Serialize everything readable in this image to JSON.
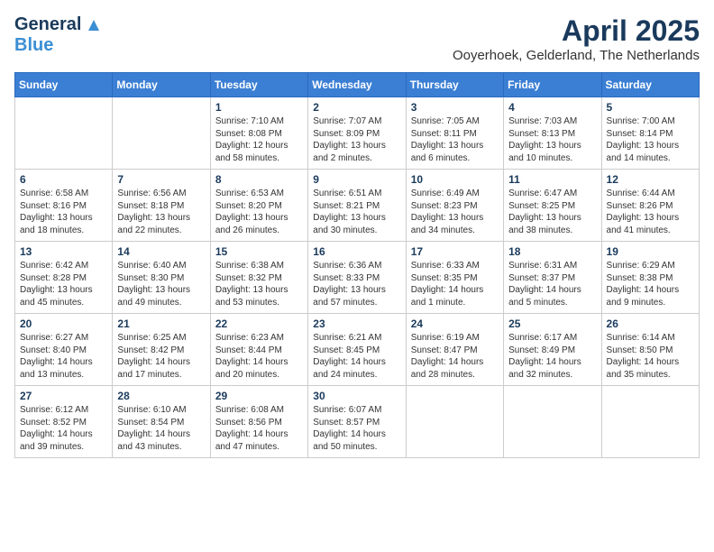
{
  "logo": {
    "general": "General",
    "blue": "Blue"
  },
  "title": "April 2025",
  "location": "Ooyerhoek, Gelderland, The Netherlands",
  "days_of_week": [
    "Sunday",
    "Monday",
    "Tuesday",
    "Wednesday",
    "Thursday",
    "Friday",
    "Saturday"
  ],
  "weeks": [
    [
      {
        "day": "",
        "info": ""
      },
      {
        "day": "",
        "info": ""
      },
      {
        "day": "1",
        "info": "Sunrise: 7:10 AM\nSunset: 8:08 PM\nDaylight: 12 hours and 58 minutes."
      },
      {
        "day": "2",
        "info": "Sunrise: 7:07 AM\nSunset: 8:09 PM\nDaylight: 13 hours and 2 minutes."
      },
      {
        "day": "3",
        "info": "Sunrise: 7:05 AM\nSunset: 8:11 PM\nDaylight: 13 hours and 6 minutes."
      },
      {
        "day": "4",
        "info": "Sunrise: 7:03 AM\nSunset: 8:13 PM\nDaylight: 13 hours and 10 minutes."
      },
      {
        "day": "5",
        "info": "Sunrise: 7:00 AM\nSunset: 8:14 PM\nDaylight: 13 hours and 14 minutes."
      }
    ],
    [
      {
        "day": "6",
        "info": "Sunrise: 6:58 AM\nSunset: 8:16 PM\nDaylight: 13 hours and 18 minutes."
      },
      {
        "day": "7",
        "info": "Sunrise: 6:56 AM\nSunset: 8:18 PM\nDaylight: 13 hours and 22 minutes."
      },
      {
        "day": "8",
        "info": "Sunrise: 6:53 AM\nSunset: 8:20 PM\nDaylight: 13 hours and 26 minutes."
      },
      {
        "day": "9",
        "info": "Sunrise: 6:51 AM\nSunset: 8:21 PM\nDaylight: 13 hours and 30 minutes."
      },
      {
        "day": "10",
        "info": "Sunrise: 6:49 AM\nSunset: 8:23 PM\nDaylight: 13 hours and 34 minutes."
      },
      {
        "day": "11",
        "info": "Sunrise: 6:47 AM\nSunset: 8:25 PM\nDaylight: 13 hours and 38 minutes."
      },
      {
        "day": "12",
        "info": "Sunrise: 6:44 AM\nSunset: 8:26 PM\nDaylight: 13 hours and 41 minutes."
      }
    ],
    [
      {
        "day": "13",
        "info": "Sunrise: 6:42 AM\nSunset: 8:28 PM\nDaylight: 13 hours and 45 minutes."
      },
      {
        "day": "14",
        "info": "Sunrise: 6:40 AM\nSunset: 8:30 PM\nDaylight: 13 hours and 49 minutes."
      },
      {
        "day": "15",
        "info": "Sunrise: 6:38 AM\nSunset: 8:32 PM\nDaylight: 13 hours and 53 minutes."
      },
      {
        "day": "16",
        "info": "Sunrise: 6:36 AM\nSunset: 8:33 PM\nDaylight: 13 hours and 57 minutes."
      },
      {
        "day": "17",
        "info": "Sunrise: 6:33 AM\nSunset: 8:35 PM\nDaylight: 14 hours and 1 minute."
      },
      {
        "day": "18",
        "info": "Sunrise: 6:31 AM\nSunset: 8:37 PM\nDaylight: 14 hours and 5 minutes."
      },
      {
        "day": "19",
        "info": "Sunrise: 6:29 AM\nSunset: 8:38 PM\nDaylight: 14 hours and 9 minutes."
      }
    ],
    [
      {
        "day": "20",
        "info": "Sunrise: 6:27 AM\nSunset: 8:40 PM\nDaylight: 14 hours and 13 minutes."
      },
      {
        "day": "21",
        "info": "Sunrise: 6:25 AM\nSunset: 8:42 PM\nDaylight: 14 hours and 17 minutes."
      },
      {
        "day": "22",
        "info": "Sunrise: 6:23 AM\nSunset: 8:44 PM\nDaylight: 14 hours and 20 minutes."
      },
      {
        "day": "23",
        "info": "Sunrise: 6:21 AM\nSunset: 8:45 PM\nDaylight: 14 hours and 24 minutes."
      },
      {
        "day": "24",
        "info": "Sunrise: 6:19 AM\nSunset: 8:47 PM\nDaylight: 14 hours and 28 minutes."
      },
      {
        "day": "25",
        "info": "Sunrise: 6:17 AM\nSunset: 8:49 PM\nDaylight: 14 hours and 32 minutes."
      },
      {
        "day": "26",
        "info": "Sunrise: 6:14 AM\nSunset: 8:50 PM\nDaylight: 14 hours and 35 minutes."
      }
    ],
    [
      {
        "day": "27",
        "info": "Sunrise: 6:12 AM\nSunset: 8:52 PM\nDaylight: 14 hours and 39 minutes."
      },
      {
        "day": "28",
        "info": "Sunrise: 6:10 AM\nSunset: 8:54 PM\nDaylight: 14 hours and 43 minutes."
      },
      {
        "day": "29",
        "info": "Sunrise: 6:08 AM\nSunset: 8:56 PM\nDaylight: 14 hours and 47 minutes."
      },
      {
        "day": "30",
        "info": "Sunrise: 6:07 AM\nSunset: 8:57 PM\nDaylight: 14 hours and 50 minutes."
      },
      {
        "day": "",
        "info": ""
      },
      {
        "day": "",
        "info": ""
      },
      {
        "day": "",
        "info": ""
      }
    ]
  ]
}
